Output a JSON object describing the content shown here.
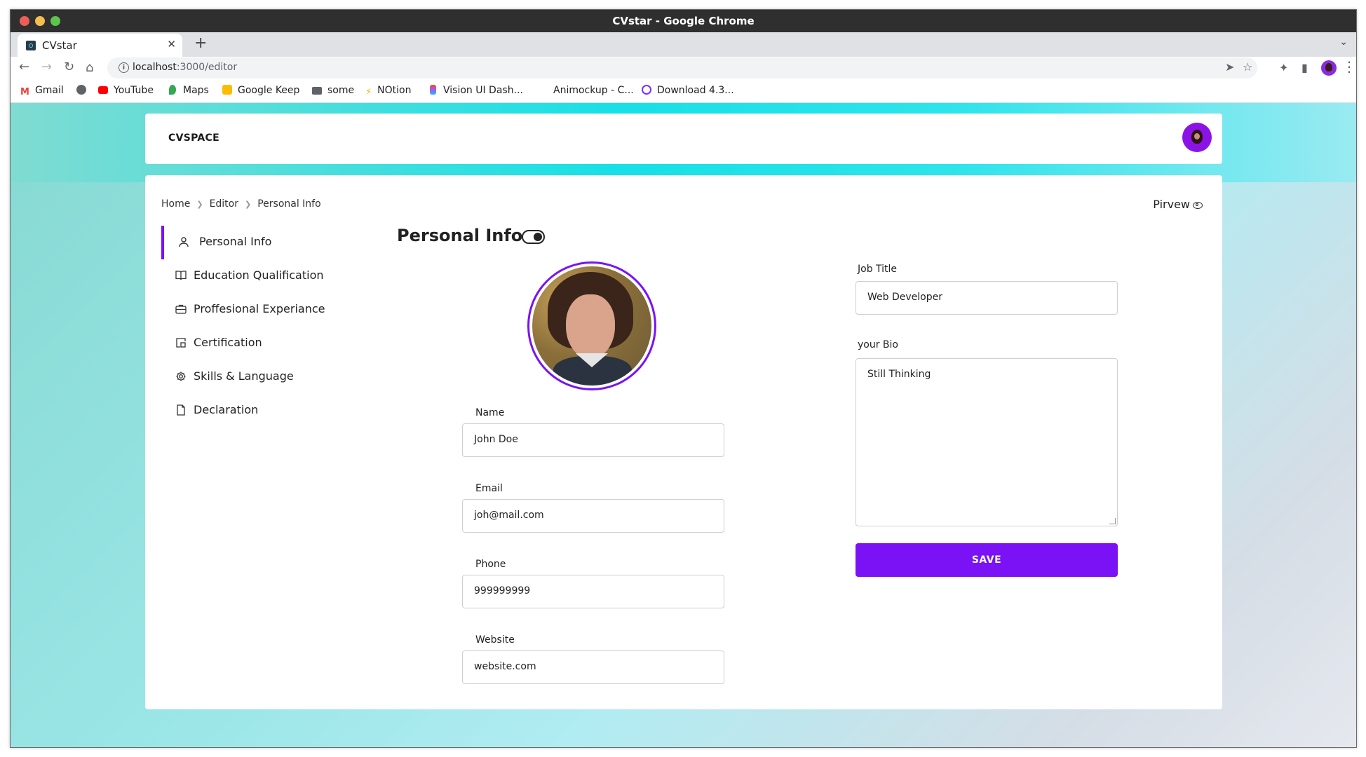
{
  "browser": {
    "window_title": "CVstar - Google Chrome",
    "tab_title": "CVstar",
    "tab_close": "✕",
    "new_tab": "+",
    "tab_menu": "⌄",
    "url_host": "localhost",
    "url_path": ":3000/editor",
    "bookmarks": [
      {
        "label": "Gmail",
        "icon": "gmail-icon",
        "color": "#ea4335"
      },
      {
        "label": "",
        "icon": "globe-icon",
        "color": "#5f6368"
      },
      {
        "label": "YouTube",
        "icon": "youtube-icon",
        "color": "#ff0000"
      },
      {
        "label": "Maps",
        "icon": "maps-icon",
        "color": "#34a853"
      },
      {
        "label": "Google Keep",
        "icon": "keep-icon",
        "color": "#fbbc04"
      },
      {
        "label": "some",
        "icon": "folder-icon",
        "color": "#5f6368"
      },
      {
        "label": "NOtion",
        "icon": "bolt-icon",
        "color": "#f4b400"
      },
      {
        "label": "Vision UI Dash...",
        "icon": "figma-icon",
        "color": "#f24e1e"
      },
      {
        "label": "Animockup - C...",
        "icon": "",
        "color": "#ffffff"
      },
      {
        "label": "Download 4.3...",
        "icon": "download-site-icon",
        "color": "#7b2ff7"
      }
    ]
  },
  "app": {
    "brand": "CVSPACE",
    "accent": "#7a12f5",
    "breadcrumb": [
      "Home",
      "Editor",
      "Personal Info"
    ],
    "preview_label": "Pirvew",
    "preview_icon": "eye-icon",
    "sidebar": [
      {
        "label": "Personal Info",
        "icon": "user-icon",
        "active": true
      },
      {
        "label": "Education Qualification",
        "icon": "book-icon",
        "active": false
      },
      {
        "label": "Proffesional Experiance",
        "icon": "briefcase-icon",
        "active": false
      },
      {
        "label": "Certification",
        "icon": "certificate-icon",
        "active": false
      },
      {
        "label": "Skills & Language",
        "icon": "gear-icon",
        "active": false
      },
      {
        "label": "Declaration",
        "icon": "document-icon",
        "active": false
      }
    ],
    "section_title": "Personal Info",
    "form": {
      "name_label": "Name",
      "name_value": "John Doe",
      "email_label": "Email",
      "email_value": "joh@mail.com",
      "phone_label": "Phone",
      "phone_value": "999999999",
      "website_label": "Website",
      "website_value": "website.com",
      "job_title_label": "Job Title",
      "job_title_value": "Web Developer",
      "bio_label": "your Bio",
      "bio_value": "Still Thinking",
      "save_label": "SAVE"
    }
  }
}
